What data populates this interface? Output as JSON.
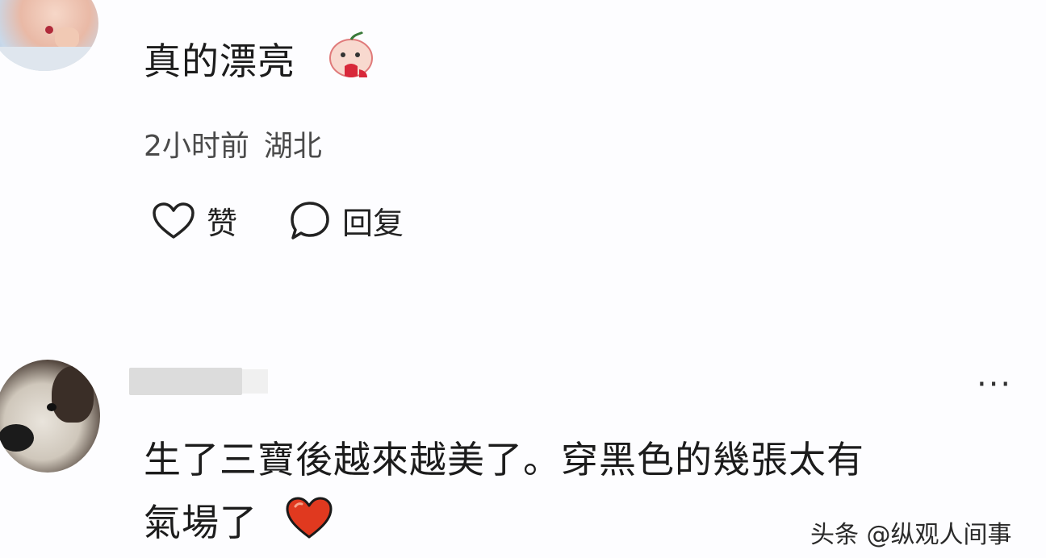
{
  "comments": [
    {
      "text": "真的漂亮",
      "time": "2小时前",
      "location": "湖北",
      "like_label": "赞",
      "reply_label": "回复"
    },
    {
      "more_label": "···",
      "text_line1": "生了三寶後越來越美了。穿黑色的幾張太有",
      "text_line2": "氣場了"
    }
  ],
  "watermark": "头条 @纵观人间事",
  "icons": {
    "like": "heart-outline-icon",
    "reply": "speech-bubble-icon",
    "emoji1": "bleeding-face-emoji",
    "emoji2": "red-heart-emoji"
  },
  "colors": {
    "background": "#fdfdff",
    "heart": "#e0391f",
    "text": "#1c1c1c"
  }
}
